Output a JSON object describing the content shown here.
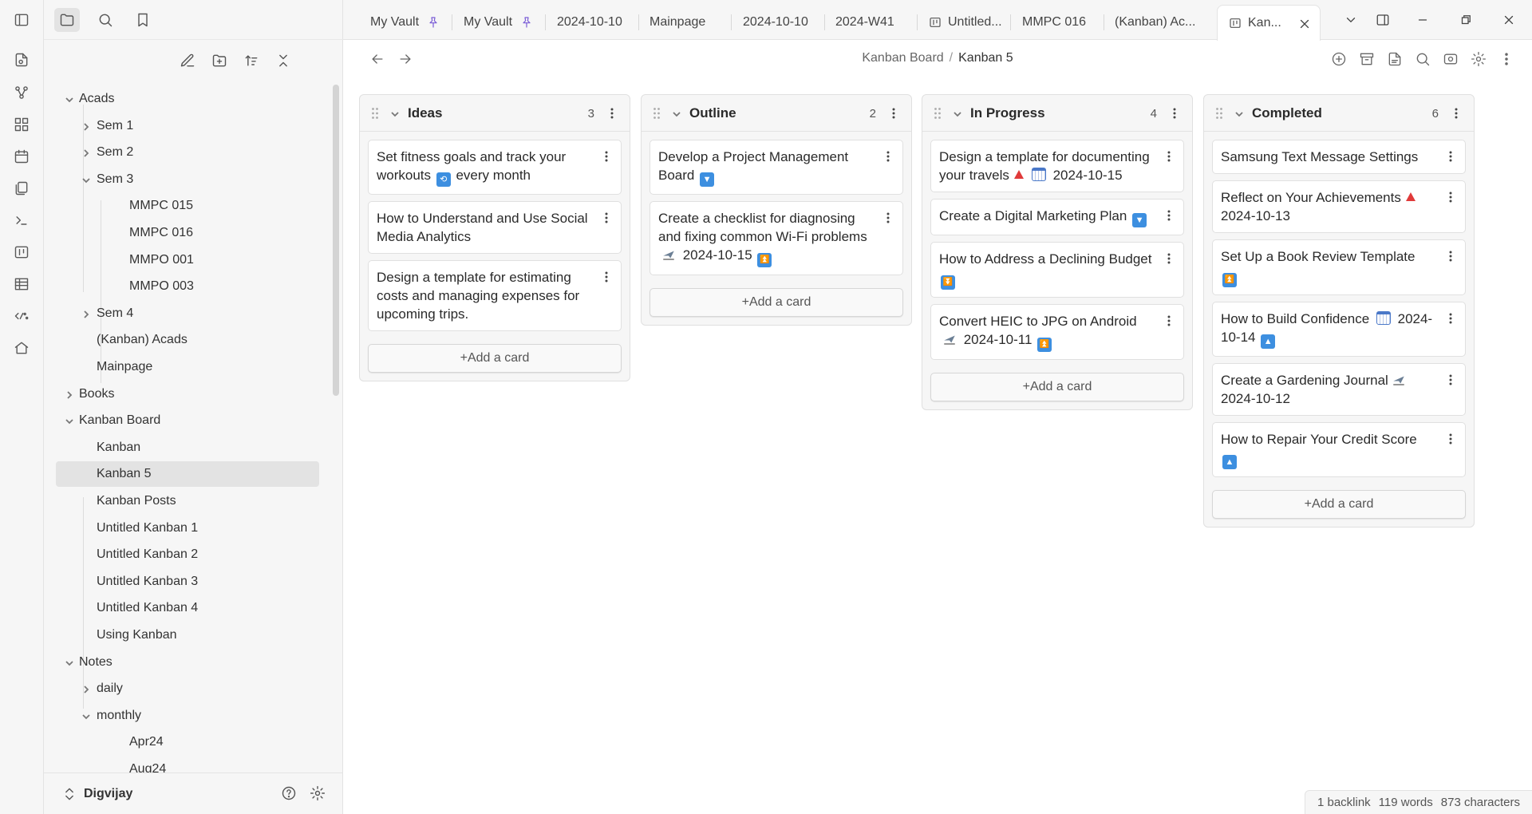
{
  "tabs": [
    {
      "label": "My Vault",
      "pinned": true
    },
    {
      "label": "My Vault",
      "pinned": true
    },
    {
      "label": "2024-10-10"
    },
    {
      "label": "Mainpage"
    },
    {
      "label": "2024-10-10"
    },
    {
      "label": "2024-W41"
    },
    {
      "label": "Untitled...",
      "icon": "kanban-icon"
    },
    {
      "label": "MMPC 016"
    },
    {
      "label": "(Kanban) Ac..."
    },
    {
      "label": "Kan...",
      "icon": "kanban-icon",
      "active": true
    }
  ],
  "breadcrumb": {
    "parent": "Kanban Board",
    "separator": "/",
    "current": "Kanban 5"
  },
  "tree": [
    {
      "label": "Acads",
      "level": 0,
      "chevron": "down"
    },
    {
      "label": "Sem 1",
      "level": 1,
      "chevron": "right"
    },
    {
      "label": "Sem 2",
      "level": 1,
      "chevron": "right"
    },
    {
      "label": "Sem 3",
      "level": 1,
      "chevron": "down"
    },
    {
      "label": "MMPC 015",
      "level": 2
    },
    {
      "label": "MMPC 016",
      "level": 2
    },
    {
      "label": "MMPO 001",
      "level": 2
    },
    {
      "label": "MMPO 003",
      "level": 2
    },
    {
      "label": "Sem 4",
      "level": 1,
      "chevron": "right"
    },
    {
      "label": "(Kanban) Acads",
      "level": 1
    },
    {
      "label": "Mainpage",
      "level": 1
    },
    {
      "label": "Books",
      "level": 0,
      "chevron": "right"
    },
    {
      "label": "Kanban Board",
      "level": 0,
      "chevron": "down"
    },
    {
      "label": "Kanban",
      "level": 1
    },
    {
      "label": "Kanban 5",
      "level": 1,
      "selected": true
    },
    {
      "label": "Kanban Posts",
      "level": 1
    },
    {
      "label": "Untitled Kanban 1",
      "level": 1
    },
    {
      "label": "Untitled Kanban 2",
      "level": 1
    },
    {
      "label": "Untitled Kanban 3",
      "level": 1
    },
    {
      "label": "Untitled Kanban 4",
      "level": 1
    },
    {
      "label": "Using Kanban",
      "level": 1
    },
    {
      "label": "Notes",
      "level": 0,
      "chevron": "down"
    },
    {
      "label": "daily",
      "level": 1,
      "chevron": "right"
    },
    {
      "label": "monthly",
      "level": 1,
      "chevron": "down"
    },
    {
      "label": "Apr24",
      "level": 2
    },
    {
      "label": "Aug24",
      "level": 2
    }
  ],
  "vault": {
    "name": "Digvijay"
  },
  "board": {
    "add_card_label": "+Add a card",
    "lanes": [
      {
        "title": "Ideas",
        "count": "3",
        "cards": [
          {
            "parts": [
              {
                "t": "Set fitness goals and track your workouts "
              },
              {
                "e": "repeat"
              },
              {
                "t": " every month"
              }
            ]
          },
          {
            "parts": [
              {
                "t": "How to Understand and Use Social Media Analytics"
              }
            ]
          },
          {
            "parts": [
              {
                "t": "Design a template for estimating costs and managing expenses for upcoming trips."
              }
            ]
          }
        ]
      },
      {
        "title": "Outline",
        "count": "2",
        "cards": [
          {
            "parts": [
              {
                "t": "Develop a Project Management Board "
              },
              {
                "e": "down"
              }
            ]
          },
          {
            "parts": [
              {
                "t": "Create a checklist for diagnosing and fixing common Wi-Fi problems "
              },
              {
                "e": "plane"
              },
              {
                "t": " 2024-10-15 "
              },
              {
                "e": "up2"
              }
            ]
          }
        ]
      },
      {
        "title": "In Progress",
        "count": "4",
        "cards": [
          {
            "parts": [
              {
                "t": "Design a template for documenting your travels"
              },
              {
                "e": "tri"
              },
              {
                "e": "cal"
              },
              {
                "t": " 2024-10-15"
              }
            ]
          },
          {
            "parts": [
              {
                "t": "Create a Digital Marketing Plan "
              },
              {
                "e": "down"
              }
            ]
          },
          {
            "parts": [
              {
                "t": "How to Address a Declining Budget "
              },
              {
                "e": "down2"
              }
            ]
          },
          {
            "parts": [
              {
                "t": "Convert HEIC to JPG on Android"
              },
              {
                "e": "plane"
              },
              {
                "t": " 2024-10-11 "
              },
              {
                "e": "up2"
              }
            ]
          }
        ]
      },
      {
        "title": "Completed",
        "count": "6",
        "cards": [
          {
            "parts": [
              {
                "t": "Samsung Text Message Settings"
              }
            ]
          },
          {
            "parts": [
              {
                "t": "Reflect on Your Achievements"
              },
              {
                "e": "tri"
              },
              {
                "t": " 2024-10-13"
              }
            ]
          },
          {
            "parts": [
              {
                "t": "Set Up a Book Review Template "
              },
              {
                "e": "up2"
              }
            ]
          },
          {
            "parts": [
              {
                "t": "How to Build Confidence "
              },
              {
                "e": "cal"
              },
              {
                "t": " 2024-10-14 "
              },
              {
                "e": "up"
              }
            ]
          },
          {
            "parts": [
              {
                "t": "Create a Gardening Journal"
              },
              {
                "e": "plane"
              },
              {
                "t": " 2024-10-12"
              }
            ]
          },
          {
            "parts": [
              {
                "t": "How to Repair Your Credit Score "
              },
              {
                "e": "up"
              }
            ]
          }
        ]
      }
    ]
  },
  "status": {
    "backlinks": "1 backlink",
    "words": "119 words",
    "characters": "873 characters"
  },
  "colors": {
    "accent_pin": "#7a5cd6",
    "emoji_blue": "#3d8fe0",
    "priority_red": "#e03a3a",
    "selected_bg": "#e3e3e3"
  }
}
